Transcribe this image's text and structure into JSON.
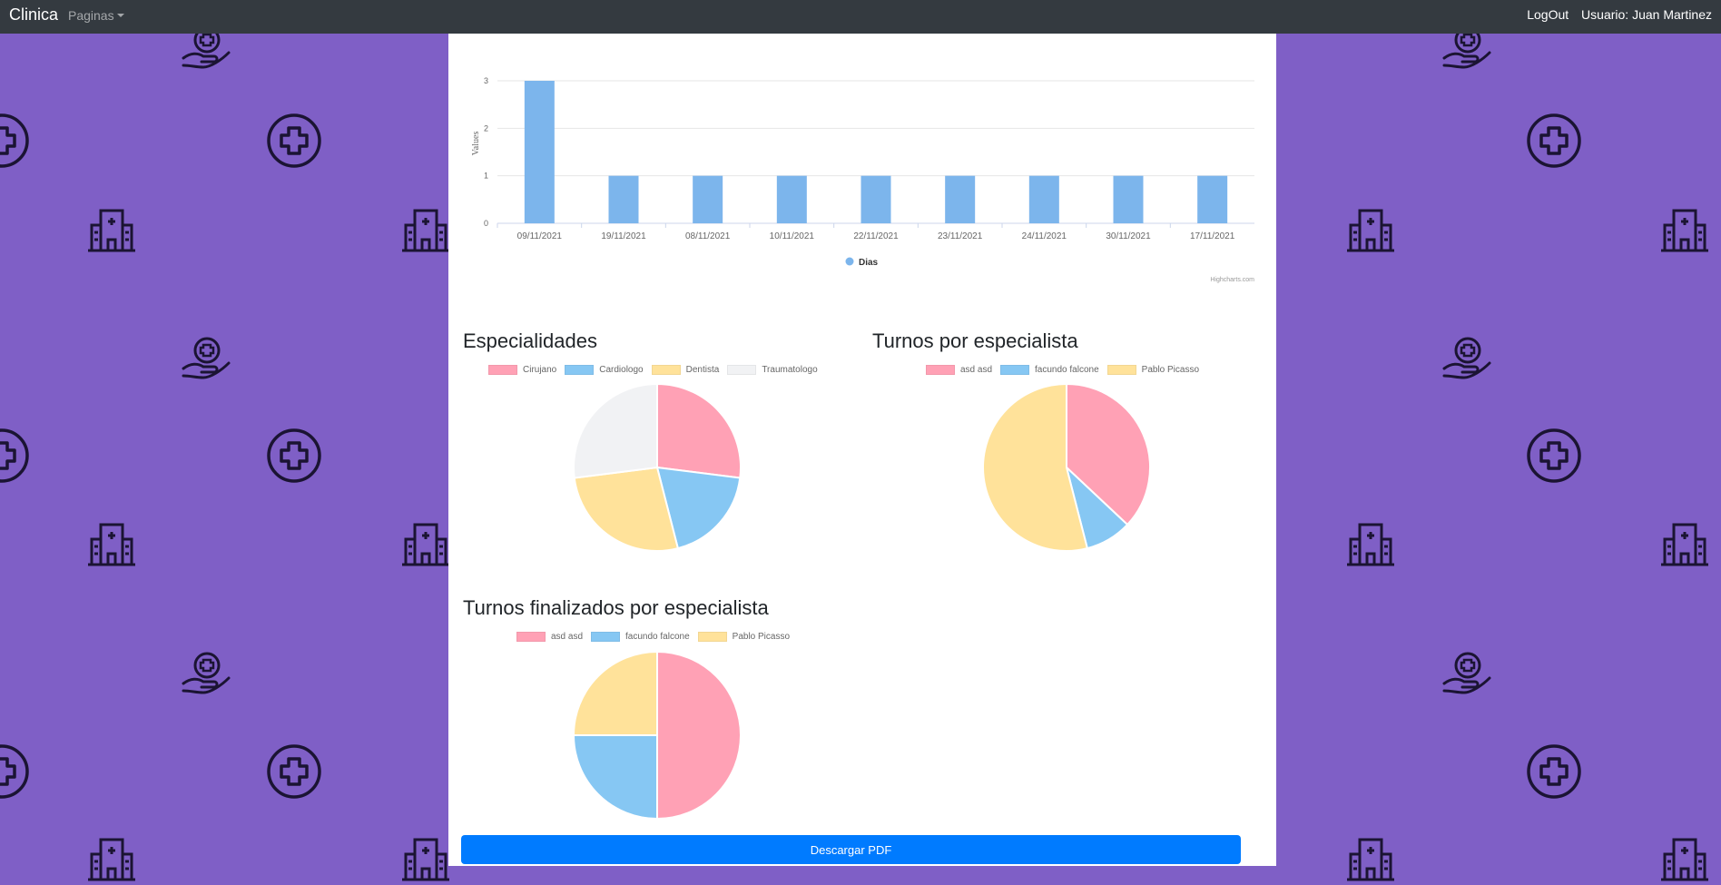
{
  "navbar": {
    "brand": "Clinica",
    "pages_label": "Paginas",
    "logout_label": "LogOut",
    "user_label": "Usuario: Juan Martinez"
  },
  "colors": {
    "background": "#7f5fc6",
    "navbar": "#343a40",
    "bar": "#7cb5ec",
    "pink": "#ffa1b5",
    "blue": "#86c7f3",
    "yellow": "#ffe29a",
    "grey": "#f1f2f4",
    "button": "#007bff"
  },
  "background_icons": [
    "hospital-icon",
    "medical-cross-icon",
    "care-hands-icon"
  ],
  "bar_chart": {
    "ylabel": "Values",
    "legend": "Dias",
    "credit": "Highcharts.com"
  },
  "download_button": "Descargar PDF",
  "chart_data": [
    {
      "type": "bar",
      "categories": [
        "09/11/2021",
        "19/11/2021",
        "08/11/2021",
        "10/11/2021",
        "22/11/2021",
        "23/11/2021",
        "24/11/2021",
        "30/11/2021",
        "17/11/2021"
      ],
      "series": [
        {
          "name": "Dias",
          "values": [
            3,
            1,
            1,
            1,
            1,
            1,
            1,
            1,
            1
          ]
        }
      ],
      "ylabel": "Values",
      "ylim": [
        0,
        3
      ],
      "yticks": [
        0,
        1,
        2,
        3
      ],
      "grid": true,
      "legend": "bottom-center"
    },
    {
      "type": "pie",
      "title": "Especialidades",
      "labels": [
        "Cirujano",
        "Cardiologo",
        "Dentista",
        "Traumatologo"
      ],
      "values": [
        27,
        19,
        27,
        27
      ],
      "colors": [
        "#ffa1b5",
        "#86c7f3",
        "#ffe29a",
        "#f1f2f4"
      ],
      "legend": "top"
    },
    {
      "type": "pie",
      "title": "Turnos por especialista",
      "labels": [
        "asd asd",
        "facundo falcone",
        "Pablo Picasso"
      ],
      "values": [
        37,
        9,
        54
      ],
      "colors": [
        "#ffa1b5",
        "#86c7f3",
        "#ffe29a"
      ],
      "legend": "top"
    },
    {
      "type": "pie",
      "title": "Turnos finalizados por especialista",
      "labels": [
        "asd asd",
        "facundo falcone",
        "Pablo Picasso"
      ],
      "values": [
        2,
        1,
        1
      ],
      "colors": [
        "#ffa1b5",
        "#86c7f3",
        "#ffe29a"
      ],
      "legend": "top"
    }
  ]
}
